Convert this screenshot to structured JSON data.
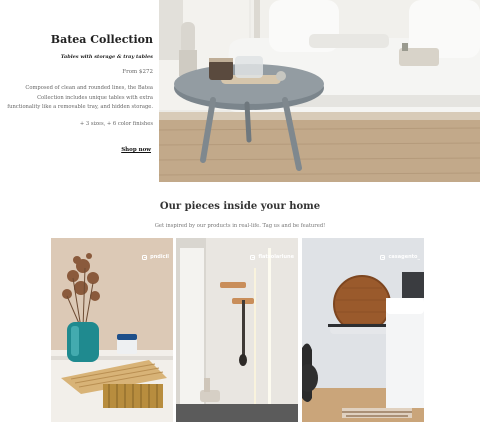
{
  "hero": {
    "title": "Batea Collection",
    "subtitle": "Tables with storage & tray tables",
    "price": "From $272",
    "description": "Composed of clean and rounded lines, the Batea Collection includes unique tables with extra functionality like a removable tray, and hidden storage.",
    "sizes": "+ 3 sizes, + 6 color finishes",
    "shop_link": "Shop now"
  },
  "gallery": {
    "title": "Our pieces inside your home",
    "subtitle": "Get inspired by our products in real-life. Tag us and be featured!",
    "photos": [
      {
        "handle": "pndicil",
        "icon": "instagram-icon"
      },
      {
        "handle": "flatsolarlune",
        "icon": "instagram-icon"
      },
      {
        "handle": "casagento_",
        "icon": "instagram-icon"
      }
    ]
  },
  "colors": {
    "text_dark": "#222222",
    "text_muted": "#666666"
  }
}
